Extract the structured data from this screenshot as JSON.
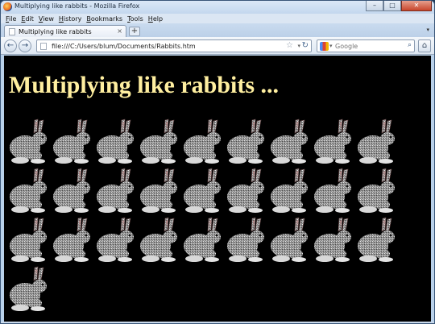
{
  "window": {
    "title": "Multiplying like rabbits - Mozilla Firefox",
    "minimize_glyph": "–",
    "maximize_glyph": "□",
    "close_glyph": "✕"
  },
  "menubar": {
    "items": [
      {
        "accel": "F",
        "rest": "ile"
      },
      {
        "accel": "E",
        "rest": "dit"
      },
      {
        "accel": "V",
        "rest": "iew"
      },
      {
        "accel": "H",
        "rest": "istory"
      },
      {
        "accel": "B",
        "rest": "ookmarks"
      },
      {
        "accel": "T",
        "rest": "ools"
      },
      {
        "accel": "H",
        "rest": "elp"
      }
    ]
  },
  "tabs": [
    {
      "label": "Multiplying like rabbits",
      "close": "×"
    }
  ],
  "new_tab_label": "+",
  "tab_list_glyph": "▾",
  "navbar": {
    "back_glyph": "←",
    "forward_glyph": "→",
    "url": "file:///C:/Users/blum/Documents/Rabbits.htm",
    "star_glyph": "☆",
    "dropdown_glyph": "▾",
    "reload_glyph": "↻",
    "search_placeholder": "Google",
    "search_engine_drop": "▾",
    "search_glyph": "⌕",
    "home_glyph": "⌂"
  },
  "page": {
    "heading": "Multiplying like rabbits ...",
    "background_color": "#000000",
    "heading_color": "#ffefa0",
    "rabbit_count": 28,
    "rabbits_per_row": 9
  }
}
